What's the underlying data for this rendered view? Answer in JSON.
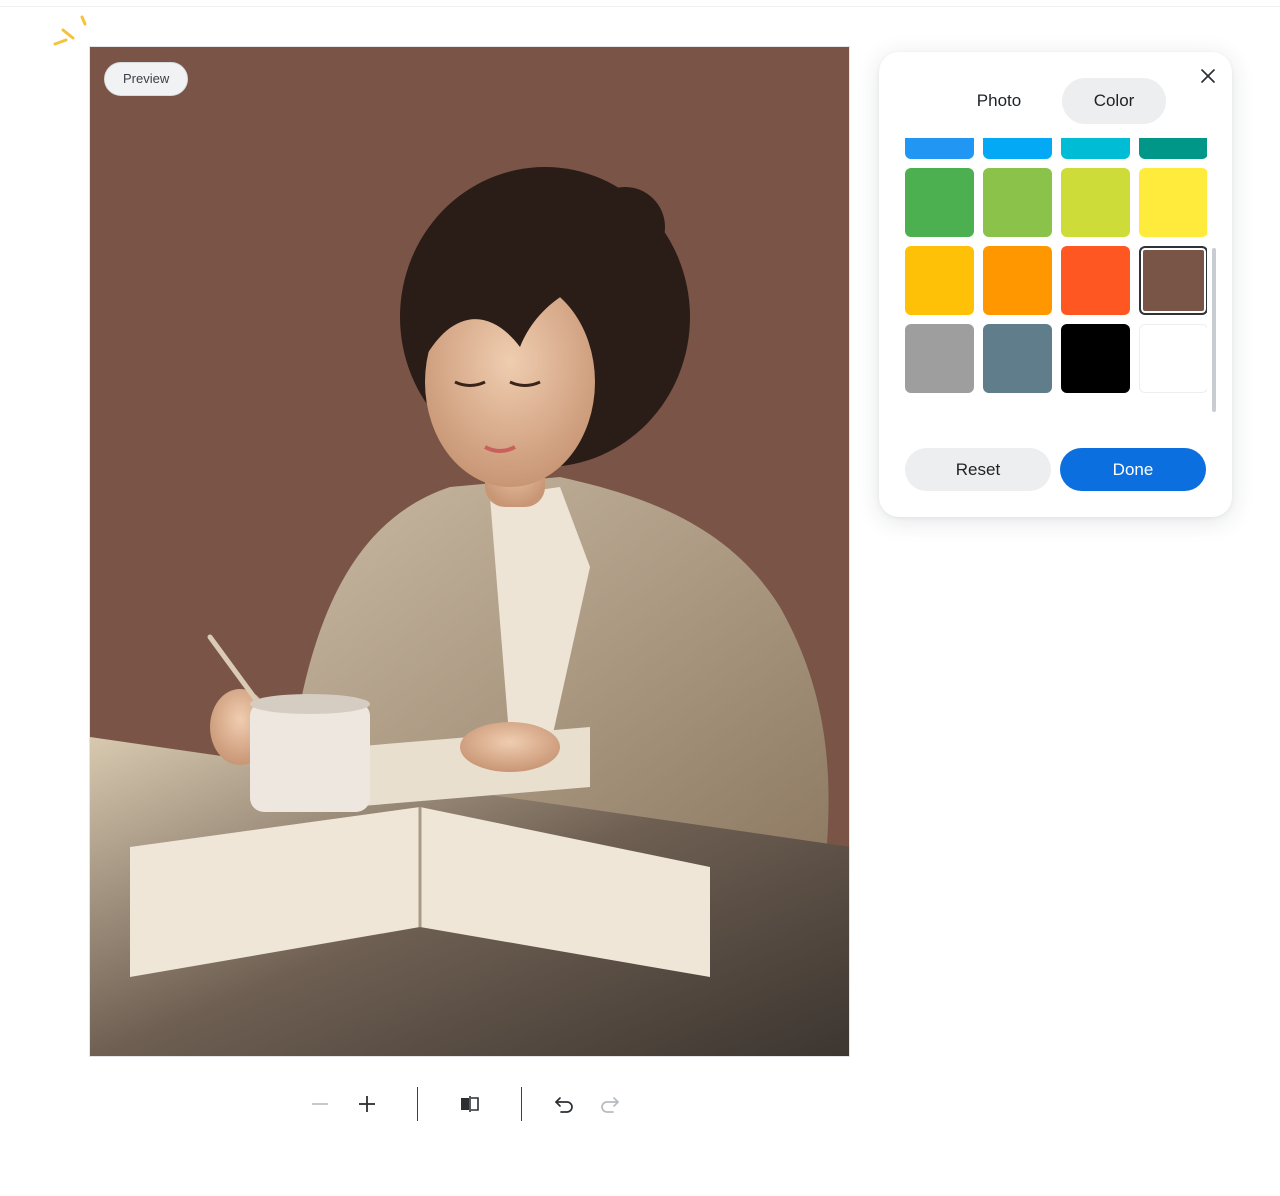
{
  "preview_badge": "Preview",
  "canvas": {
    "background_color": "#7A5446"
  },
  "toolbar": {
    "zoom_out_icon": "minus-icon",
    "zoom_in_icon": "plus-icon",
    "compare_icon": "split-compare-icon",
    "undo_icon": "undo-icon",
    "redo_icon": "redo-icon"
  },
  "panel": {
    "tabs": [
      {
        "label": "Photo",
        "active": false
      },
      {
        "label": "Color",
        "active": true
      }
    ],
    "close_icon": "close-icon",
    "swatches": [
      {
        "name": "blue",
        "color": "#2196F3"
      },
      {
        "name": "light-blue",
        "color": "#03A9F4"
      },
      {
        "name": "cyan",
        "color": "#00BCD4"
      },
      {
        "name": "teal",
        "color": "#009688"
      },
      {
        "name": "green",
        "color": "#4CAF50"
      },
      {
        "name": "light-green",
        "color": "#8BC34A"
      },
      {
        "name": "lime",
        "color": "#CDDC39"
      },
      {
        "name": "yellow",
        "color": "#FFEB3B"
      },
      {
        "name": "amber",
        "color": "#FFC107"
      },
      {
        "name": "orange",
        "color": "#FF9800"
      },
      {
        "name": "deep-orange",
        "color": "#FF5722"
      },
      {
        "name": "brown",
        "color": "#795548",
        "selected": true
      },
      {
        "name": "grey",
        "color": "#9E9E9E"
      },
      {
        "name": "blue-grey",
        "color": "#607D8B"
      },
      {
        "name": "black",
        "color": "#000000"
      },
      {
        "name": "white",
        "color": "#FFFFFF"
      }
    ],
    "reset_label": "Reset",
    "done_label": "Done",
    "accent_color": "#0B6FDF"
  }
}
